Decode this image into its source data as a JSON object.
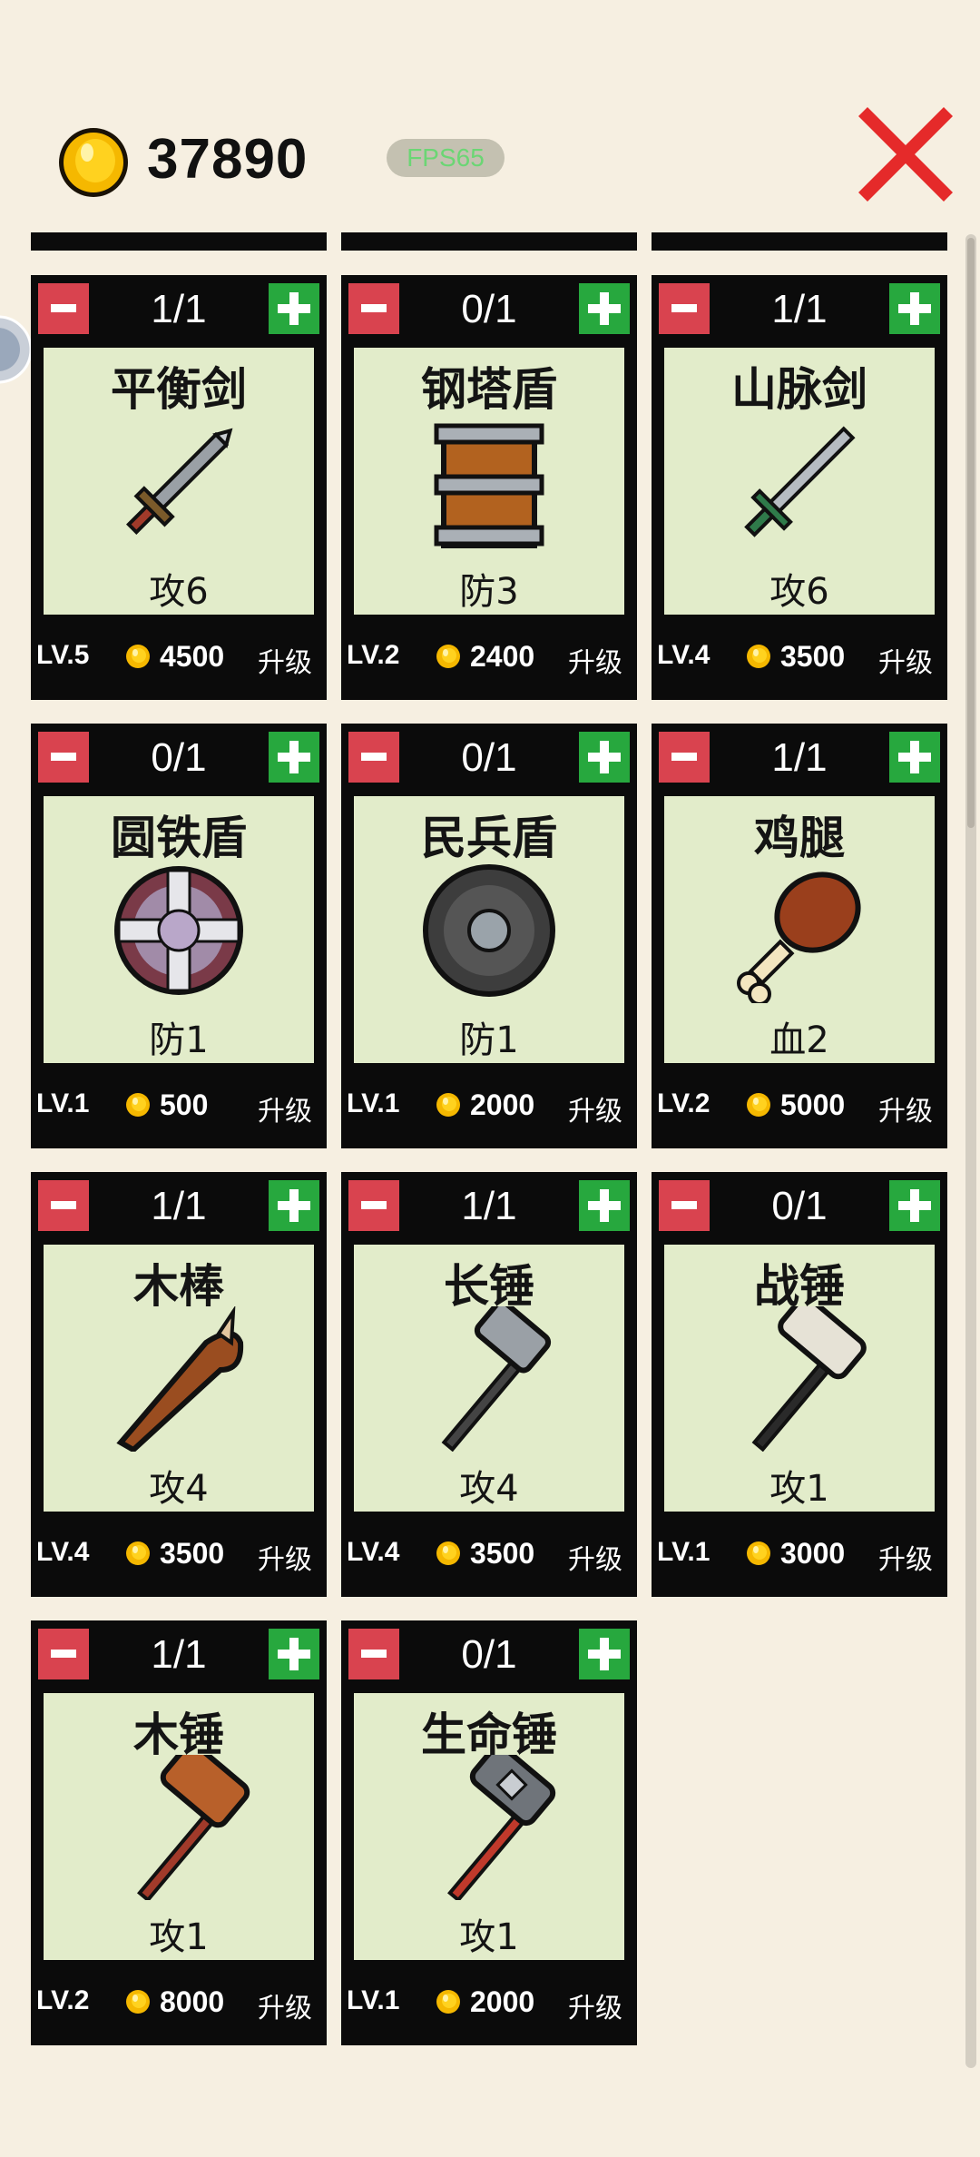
{
  "header": {
    "gold": "37890",
    "fps": "FPS65"
  },
  "icons": {
    "coin": "gold-coin-icon",
    "close": "close-x-icon"
  },
  "colors": {
    "minus": "#d9434f",
    "plus": "#27a83e",
    "panel": "#e2ecca",
    "background": "#f6efe1",
    "close": "#e52a2a"
  },
  "items": [
    {
      "count": "1/1",
      "name": "平衡剑",
      "stat": "攻6",
      "level": "LV.5",
      "price": "4500",
      "upgrade": "升级",
      "icon": "balance-sword"
    },
    {
      "count": "0/1",
      "name": "钢塔盾",
      "stat": "防3",
      "level": "LV.2",
      "price": "2400",
      "upgrade": "升级",
      "icon": "tower-shield"
    },
    {
      "count": "1/1",
      "name": "山脉剑",
      "stat": "攻6",
      "level": "LV.4",
      "price": "3500",
      "upgrade": "升级",
      "icon": "mountain-sword"
    },
    {
      "count": "0/1",
      "name": "圆铁盾",
      "stat": "防1",
      "level": "LV.1",
      "price": "500",
      "upgrade": "升级",
      "icon": "round-iron-shield"
    },
    {
      "count": "0/1",
      "name": "民兵盾",
      "stat": "防1",
      "level": "LV.1",
      "price": "2000",
      "upgrade": "升级",
      "icon": "militia-shield"
    },
    {
      "count": "1/1",
      "name": "鸡腿",
      "stat": "血2",
      "level": "LV.2",
      "price": "5000",
      "upgrade": "升级",
      "icon": "chicken-leg"
    },
    {
      "count": "1/1",
      "name": "木棒",
      "stat": "攻4",
      "level": "LV.4",
      "price": "3500",
      "upgrade": "升级",
      "icon": "wooden-club"
    },
    {
      "count": "1/1",
      "name": "长锤",
      "stat": "攻4",
      "level": "LV.4",
      "price": "3500",
      "upgrade": "升级",
      "icon": "long-hammer"
    },
    {
      "count": "0/1",
      "name": "战锤",
      "stat": "攻1",
      "level": "LV.1",
      "price": "3000",
      "upgrade": "升级",
      "icon": "war-hammer"
    },
    {
      "count": "1/1",
      "name": "木锤",
      "stat": "攻1",
      "level": "LV.2",
      "price": "8000",
      "upgrade": "升级",
      "icon": "wooden-mallet"
    },
    {
      "count": "0/1",
      "name": "生命锤",
      "stat": "攻1",
      "level": "LV.1",
      "price": "2000",
      "upgrade": "升级",
      "icon": "life-hammer"
    }
  ]
}
